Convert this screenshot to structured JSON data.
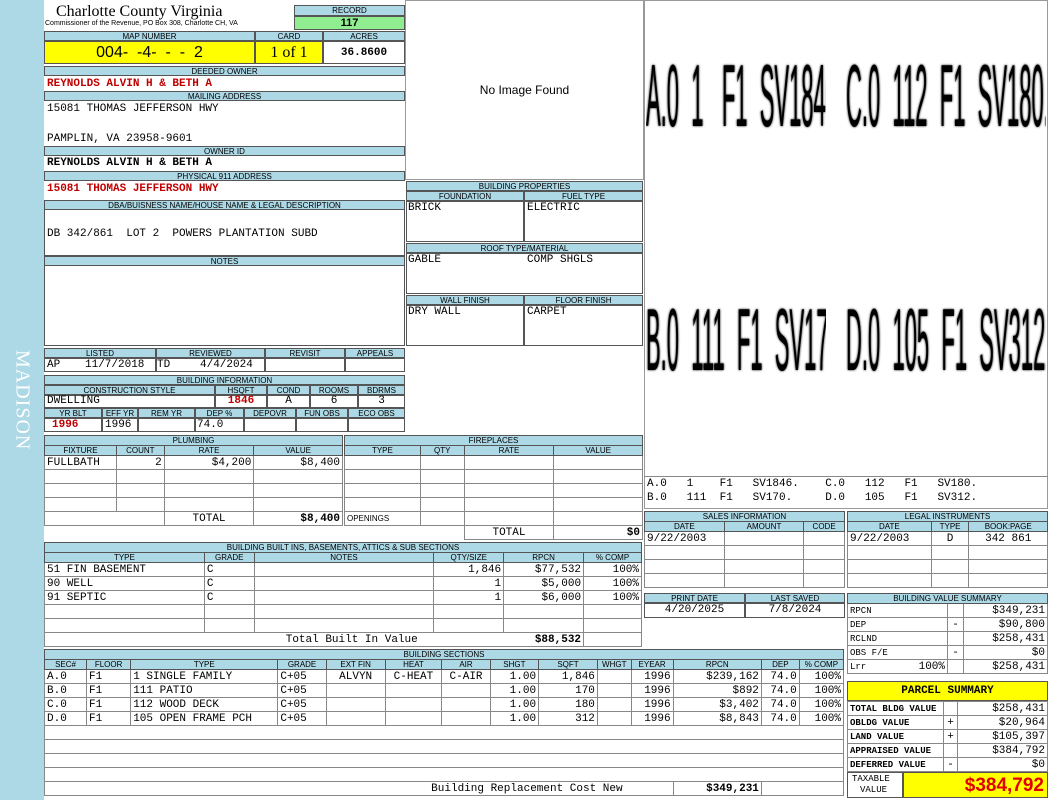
{
  "sidebar": {
    "label": "MADISON"
  },
  "header": {
    "county": "Charlotte County Virginia",
    "commissioner": "Commissioner of the Revenue, PO Box 308, Charlotte CH, VA",
    "record_label": "RECORD",
    "record_value": "117",
    "map_label": "MAP NUMBER",
    "map_value": "004-  -4-  -  -  2",
    "card_label": "CARD",
    "card_value": "1 of 1",
    "acres_label": "ACRES",
    "acres_value": "36.8600"
  },
  "owner": {
    "deeded_label": "DEEDED OWNER",
    "deeded_value": "REYNOLDS ALVIN H & BETH A",
    "mailing_label": "MAILING ADDRESS",
    "mailing_line1": "15081 THOMAS JEFFERSON HWY",
    "mailing_line2": "PAMPLIN, VA 23958-9601",
    "owner_id_label": "OWNER ID",
    "owner_id_value": "REYNOLDS ALVIN H & BETH A",
    "physical_label": "PHYSICAL 911 ADDRESS",
    "physical_value": "15081 THOMAS JEFFERSON HWY"
  },
  "legal": {
    "label": "DBA/BUISNESS NAME/HOUSE NAME & LEGAL DESCRIPTION",
    "value": "DB 342/861  LOT 2  POWERS PLANTATION SUBD"
  },
  "notes": {
    "label": "NOTES"
  },
  "image": {
    "text": "No Image Found"
  },
  "listing": {
    "listed_label": "LISTED",
    "reviewed_label": "REVIEWED",
    "revisit_label": "REVISIT",
    "appeals_label": "APPEALS",
    "listed_by": "AP",
    "listed_date": "11/7/2018",
    "reviewed_by": "TD",
    "reviewed_date": "4/4/2024"
  },
  "building_info": {
    "label": "BUILDING INFORMATION",
    "style_label": "CONSTRUCTION STYLE",
    "hsqft_label": "HSQFT",
    "cond_label": "COND",
    "rooms_label": "ROOMS",
    "bdrms_label": "BDRMS",
    "style": "DWELLING",
    "hsqft": "1846",
    "cond": "A",
    "rooms": "6",
    "bdrms": "3",
    "yrblt_label": "YR BLT",
    "effyr_label": "EFF YR",
    "remyr_label": "REM YR",
    "dep_label": "DEP %",
    "depovr_label": "DEPOVR",
    "funobs_label": "FUN OBS",
    "ecoobs_label": "ECO OBS",
    "yrblt": "1996",
    "effyr": "1996",
    "dep": "74.0"
  },
  "building_props": {
    "label": "BUILDING PROPERTIES",
    "foundation_label": "FOUNDATION",
    "fuel_label": "FUEL TYPE",
    "foundation": "BRICK",
    "fuel": "ELECTRIC",
    "roof_label": "ROOF TYPE/MATERIAL",
    "roof_type": "GABLE",
    "roof_material": "COMP SHGLS",
    "wall_label": "WALL FINISH",
    "floor_label": "FLOOR FINISH",
    "wall": "DRY WALL",
    "floor": "CARPET"
  },
  "sketch": {
    "labels": [
      "A.0  1   F1  SV1846.",
      "C.0  112  F1  SV180.",
      "B.0  111  F1  SV170.",
      "D.0  105  F1  SV312."
    ],
    "legend_line1": "A.0   1    F1   SV1846.    C.0   112   F1   SV180.",
    "legend_line2": "B.0   111  F1   SV170.     D.0   105   F1   SV312."
  },
  "plumbing": {
    "label": "PLUMBING",
    "cols": [
      "FIXTURE",
      "COUNT",
      "RATE",
      "VALUE"
    ],
    "rows": [
      [
        "FULLBATH",
        "2",
        "$4,200",
        "$8,400"
      ]
    ],
    "total_label": "TOTAL",
    "total_value": "$8,400"
  },
  "fireplaces": {
    "label": "FIREPLACES",
    "cols": [
      "TYPE",
      "QTY",
      "RATE",
      "VALUE"
    ],
    "openings_label": "OPENINGS",
    "total_label": "TOTAL",
    "total_value": "$0"
  },
  "sales": {
    "label": "SALES INFORMATION",
    "cols": [
      "DATE",
      "AMOUNT",
      "CODE"
    ],
    "rows": [
      [
        "9/22/2003",
        "",
        ""
      ]
    ]
  },
  "legal_instruments": {
    "label": "LEGAL INSTRUMENTS",
    "cols": [
      "DATE",
      "TYPE",
      "BOOK:PAGE"
    ],
    "rows": [
      [
        "9/22/2003",
        "D",
        "342 861"
      ]
    ]
  },
  "print_info": {
    "print_label": "PRINT DATE",
    "saved_label": "LAST SAVED",
    "print_date": "4/20/2025",
    "saved_date": "7/8/2024"
  },
  "built_ins": {
    "label": "BUILDING BUILT INS, BASEMENTS, ATTICS & SUB SECTIONS",
    "cols": [
      "TYPE",
      "GRADE",
      "NOTES",
      "QTY/SIZE",
      "RPCN",
      "% COMP"
    ],
    "rows": [
      [
        "51 FIN BASEMENT",
        "C",
        "",
        "1,846",
        "$77,532",
        "100%"
      ],
      [
        "90 WELL",
        "C",
        "",
        "1",
        "$5,000",
        "100%"
      ],
      [
        "91 SEPTIC",
        "C",
        "",
        "1",
        "$6,000",
        "100%"
      ]
    ],
    "total_label": "Total Built In Value",
    "total_value": "$88,532"
  },
  "value_summary": {
    "label": "BUILDING VALUE SUMMARY",
    "rows": [
      [
        "RPCN",
        "",
        "",
        "$349,231"
      ],
      [
        "DEP",
        "",
        "-",
        "$90,800"
      ],
      [
        "RCLND",
        "",
        "",
        "$258,431"
      ],
      [
        "OBS F/E",
        "",
        "-",
        "$0"
      ],
      [
        "Lrr",
        "100%",
        "",
        "$258,431"
      ]
    ]
  },
  "parcel": {
    "label": "PARCEL SUMMARY",
    "rows": [
      [
        "TOTAL BLDG VALUE",
        "",
        "$258,431"
      ],
      [
        "OBLDG VALUE",
        "+",
        "$20,964"
      ],
      [
        "LAND VALUE",
        "+",
        "$105,397"
      ],
      [
        "APPRAISED VALUE",
        "",
        "$384,792"
      ],
      [
        "DEFERRED VALUE",
        "-",
        "$0"
      ]
    ],
    "taxable_label_1": "TAXABLE",
    "taxable_label_2": "VALUE",
    "taxable_value": "$384,792"
  },
  "sections": {
    "label": "BUILDING SECTIONS",
    "cols": [
      "SEC#",
      "FLOOR",
      "TYPE",
      "GRADE",
      "EXT FIN",
      "HEAT",
      "AIR",
      "SHGT",
      "SQFT",
      "WHGT",
      "EYEAR",
      "RPCN",
      "DEP",
      "% COMP"
    ],
    "rows": [
      [
        "A.0",
        "F1",
        "1 SINGLE FAMILY",
        "C+05",
        "ALVYN",
        "C-HEAT",
        "C-AIR",
        "1.00",
        "1,846",
        "",
        "1996",
        "$239,162",
        "74.0",
        "100%"
      ],
      [
        "B.0",
        "F1",
        "111 PATIO",
        "C+05",
        "",
        "",
        "",
        "1.00",
        "170",
        "",
        "1996",
        "$892",
        "74.0",
        "100%"
      ],
      [
        "C.0",
        "F1",
        "112 WOOD DECK",
        "C+05",
        "",
        "",
        "",
        "1.00",
        "180",
        "",
        "1996",
        "$3,402",
        "74.0",
        "100%"
      ],
      [
        "D.0",
        "F1",
        "105 OPEN FRAME PCH",
        "C+05",
        "",
        "",
        "",
        "1.00",
        "312",
        "",
        "1996",
        "$8,843",
        "74.0",
        "100%"
      ]
    ],
    "total_label": "Building Replacement Cost New",
    "total_value": "$349,231"
  }
}
